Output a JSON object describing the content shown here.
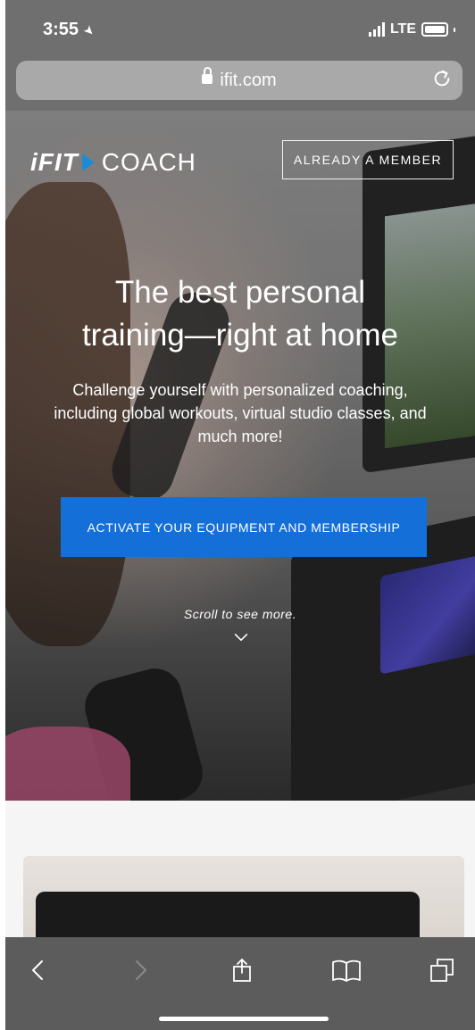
{
  "status_bar": {
    "time": "3:55",
    "network": "LTE",
    "location_icon": "location-arrow-icon",
    "signal_icon": "signal-bars-icon",
    "battery_icon": "battery-icon"
  },
  "browser": {
    "url": "ifit.com",
    "lock_icon": "lock-icon",
    "reload_icon": "reload-icon"
  },
  "header": {
    "logo_brand": "iFIT",
    "logo_product": "COACH",
    "member_button": "ALREADY A MEMBER"
  },
  "hero": {
    "headline_line1": "The best personal",
    "headline_line2": "training—right at home",
    "subheading": "Challenge yourself with personalized coaching, including global workouts, virtual studio classes, and much more!",
    "cta_label": "ACTIVATE YOUR EQUIPMENT AND MEMBERSHIP",
    "scroll_hint": "Scroll to see more.",
    "scroll_icon": "chevron-down-icon"
  },
  "toolbar": {
    "back_icon": "chevron-left-icon",
    "forward_icon": "chevron-right-icon",
    "share_icon": "share-icon",
    "bookmarks_icon": "book-icon",
    "tabs_icon": "tabs-icon"
  },
  "colors": {
    "accent": "#1470d8",
    "logo_arrow": "#1e8ad6",
    "browser_chrome": "#6f6f6f"
  }
}
